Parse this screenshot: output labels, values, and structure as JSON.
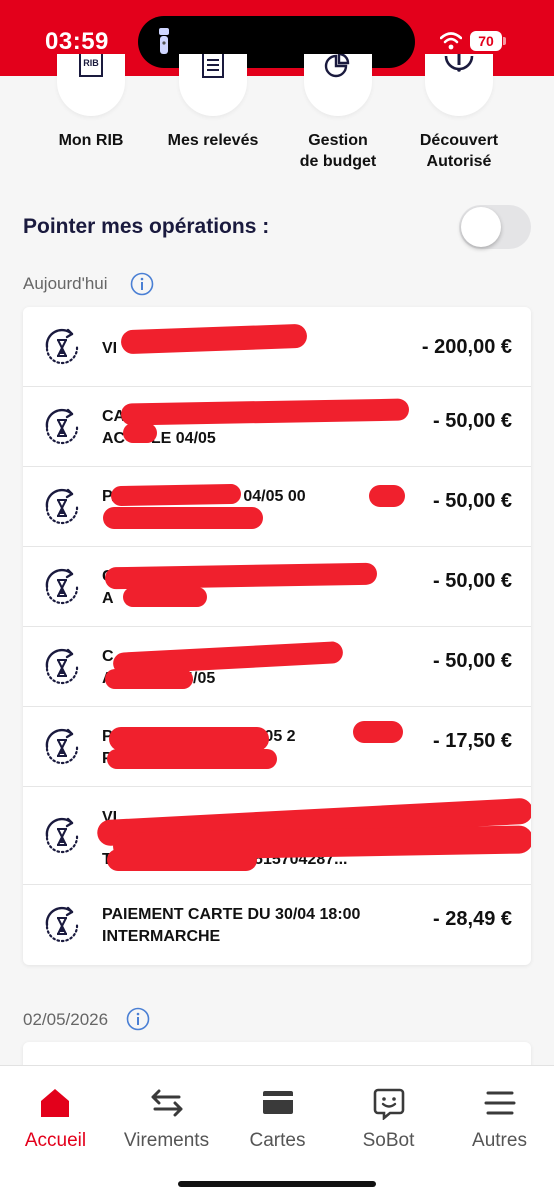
{
  "status": {
    "time": "03:59",
    "battery": "70"
  },
  "shortcuts": [
    {
      "label": "Mon RIB",
      "icon": "rib-icon",
      "icon_text": "RIB"
    },
    {
      "label": "Mes relevés",
      "icon": "statement-icon"
    },
    {
      "label": "Gestion de budget",
      "icon": "pie-chart-icon"
    },
    {
      "label": "Découvert Autorisé",
      "icon": "exclamation-icon"
    }
  ],
  "pointer": {
    "label": "Pointer mes opérations :",
    "enabled": false
  },
  "sections": [
    {
      "title": "Aujourd'hui"
    },
    {
      "title": "02/05/2026"
    }
  ],
  "operations": [
    {
      "line1": "VI",
      "line2": "",
      "amount": "- 200,00 €"
    },
    {
      "line1": "CA",
      "line2": "AC   OLE 04/05",
      "amount": "- 50,00 €"
    },
    {
      "line1": "PA                     DU 04/05 00",
      "line2": "                            D",
      "amount": "- 50,00 €"
    },
    {
      "line1": "C",
      "line2": "A              4/05",
      "amount": "- 50,00 €"
    },
    {
      "line1": "C                        CREDIT",
      "line2": "A              04/05",
      "amount": "- 50,00 €"
    },
    {
      "line1": "P                       DU 03/05 2",
      "line2": "P",
      "amount": "- 17,50 €"
    },
    {
      "line1": "VI",
      "line2": "",
      "line3": "T                        0000515704287...",
      "amount": ""
    },
    {
      "line1": "PAIEMENT CARTE DU 30/04 18:00",
      "line2": "INTERMARCHE",
      "amount": "- 28,49 €"
    }
  ],
  "nav": [
    {
      "label": "Accueil",
      "icon": "home-icon",
      "active": true
    },
    {
      "label": "Virements",
      "icon": "transfer-icon",
      "active": false
    },
    {
      "label": "Cartes",
      "icon": "card-icon",
      "active": false
    },
    {
      "label": "SoBot",
      "icon": "chatbot-icon",
      "active": false
    },
    {
      "label": "Autres",
      "icon": "menu-icon",
      "active": false
    }
  ],
  "colors": {
    "brand": "#e3001b",
    "navy": "#1a1a3e",
    "redaction": "#f0202d"
  }
}
